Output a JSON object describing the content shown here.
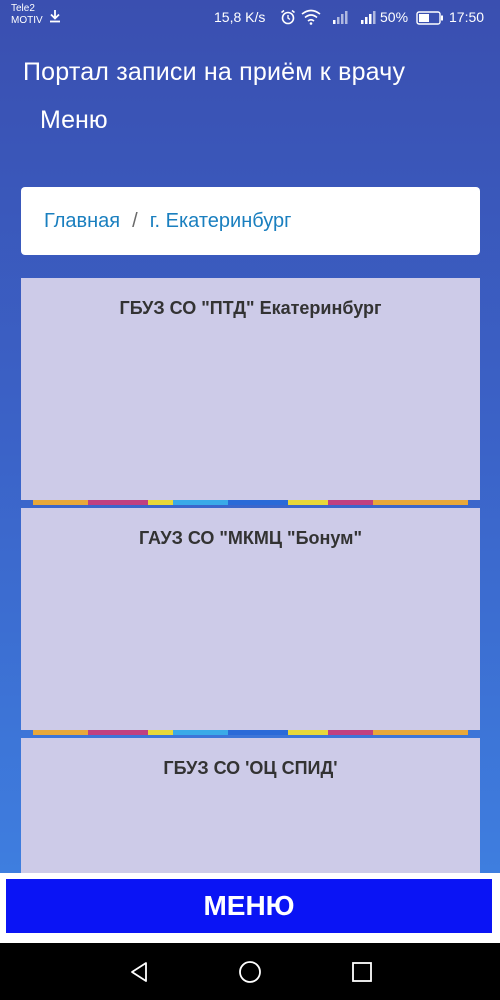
{
  "status_bar": {
    "carrier_line1": "Tele2",
    "carrier_line2": "MOTIV",
    "network_speed": "15,8 K/s",
    "battery": "50%",
    "time": "17:50",
    "icons": [
      "download-icon",
      "alarm-icon",
      "wifi-icon",
      "signal-icon",
      "signal-icon",
      "battery-icon"
    ]
  },
  "header": {
    "title": "Портал записи на приём к врачу",
    "menu_label": "Меню"
  },
  "breadcrumb": {
    "items": [
      "Главная",
      "г. Екатеринбург"
    ],
    "separator": "/"
  },
  "clinics": [
    {
      "name": "ГБУЗ СО \"ПТД\" Екатеринбург"
    },
    {
      "name": "ГАУЗ СО \"МКМЦ \"Бонум\""
    },
    {
      "name": "ГБУЗ СО 'ОЦ СПИД'"
    }
  ],
  "bottom_button": {
    "label": "МЕНЮ"
  },
  "nav_bar": {
    "icons": [
      "back-icon",
      "home-icon",
      "recents-icon"
    ]
  },
  "colors": {
    "card_background": "#cdcbe8",
    "link": "#1a7fbf",
    "menu_button": "#0a14f5",
    "stripe": [
      "#e8a83a",
      "#c04080",
      "#e8d83a",
      "#3aaae8",
      "#2a6ad8",
      "#e8d83a",
      "#c04080",
      "#e8a83a"
    ]
  }
}
